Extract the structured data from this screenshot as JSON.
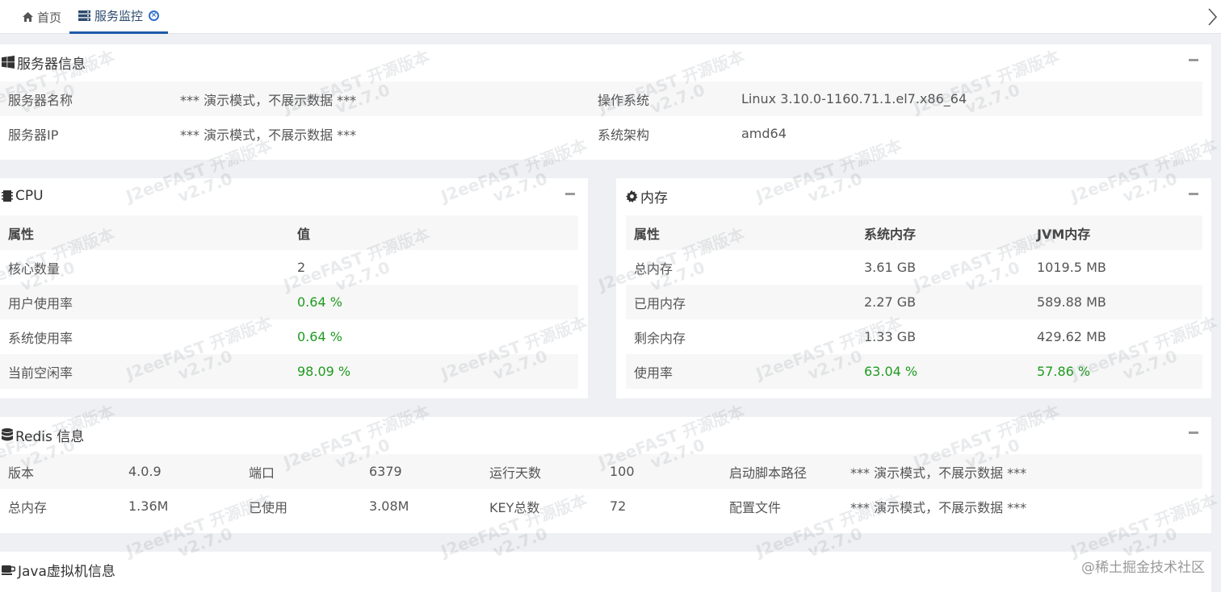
{
  "tabs": [
    {
      "label": "首页",
      "icon": "home-icon"
    },
    {
      "label": "服务监控",
      "icon": "server-list-icon",
      "close_icon": "close-circle-icon"
    }
  ],
  "server": {
    "title": "服务器信息",
    "icon": "windows-icon",
    "rows": [
      [
        "服务器名称",
        "*** 演示模式，不展示数据 ***",
        "操作系统",
        "Linux 3.10.0-1160.71.1.el7.x86_64"
      ],
      [
        "服务器IP",
        "*** 演示模式，不展示数据 ***",
        "系统架构",
        "amd64"
      ]
    ]
  },
  "cpu": {
    "title": "CPU",
    "icon": "cpu-chip-icon",
    "headers": [
      "属性",
      "值"
    ],
    "rows": [
      [
        "核心数量",
        "2"
      ],
      [
        "用户使用率",
        "0.64 %"
      ],
      [
        "系统使用率",
        "0.64 %"
      ],
      [
        "当前空闲率",
        "98.09 %"
      ]
    ]
  },
  "memory": {
    "title": "内存",
    "icon": "gear-icon",
    "headers": [
      "属性",
      "系统内存",
      "JVM内存"
    ],
    "rows": [
      [
        "总内存",
        "3.61 GB",
        "1019.5 MB"
      ],
      [
        "已用内存",
        "2.27 GB",
        "589.88 MB"
      ],
      [
        "剩余内存",
        "1.33 GB",
        "429.62 MB"
      ],
      [
        "使用率",
        "63.04 %",
        "57.86 %"
      ]
    ]
  },
  "redis": {
    "title": "Redis 信息",
    "icon": "database-icon",
    "rows": [
      [
        "版本",
        "4.0.9",
        "端口",
        "6379",
        "运行天数",
        "100",
        "启动脚本路径",
        "*** 演示模式，不展示数据 ***"
      ],
      [
        "总内存",
        "1.36M",
        "已使用",
        "3.08M",
        "KEY总数",
        "72",
        "配置文件",
        "*** 演示模式，不展示数据 ***"
      ]
    ]
  },
  "jvm": {
    "title": "Java虚拟机信息",
    "icon": "coffee-cup-icon"
  },
  "watermark": {
    "line1": "J2eeFAST 开源版本",
    "line2": "v2.7.0"
  },
  "footer_mark": "@稀土掘金技术社区",
  "colors": {
    "accent": "#1e5aa8",
    "good": "#1f9b1f",
    "bg": "#eef0f3"
  }
}
